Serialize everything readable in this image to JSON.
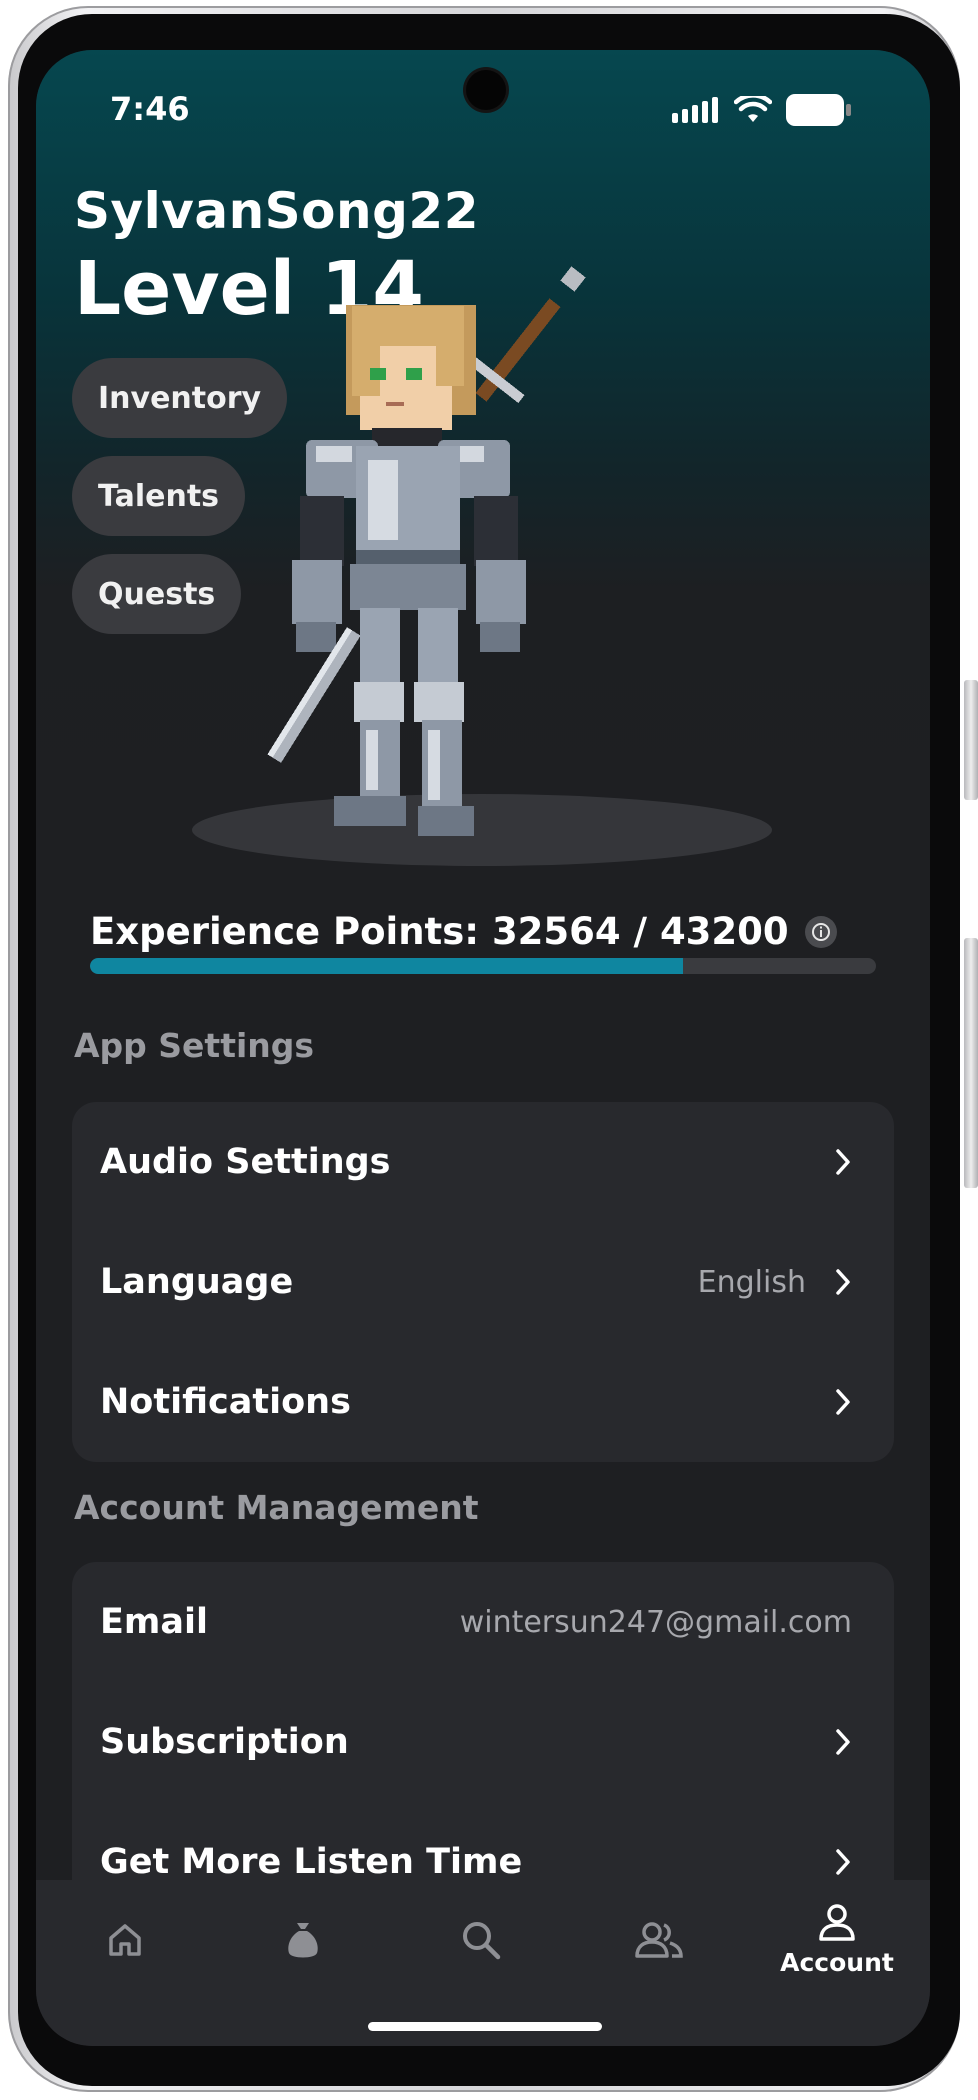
{
  "status_bar": {
    "time": "7:46"
  },
  "profile": {
    "username": "SylvanSong22",
    "level": "Level 14"
  },
  "menu_chips": [
    {
      "label": "Inventory"
    },
    {
      "label": "Talents"
    },
    {
      "label": "Quests"
    }
  ],
  "experience": {
    "label": "Experience Points: 32564 / 43200",
    "current": 32564,
    "max": 43200,
    "fraction": 0.754
  },
  "app_settings": {
    "title": "App Settings",
    "rows": [
      {
        "label": "Audio Settings",
        "value": ""
      },
      {
        "label": "Language",
        "value": "English"
      },
      {
        "label": "Notifications",
        "value": ""
      }
    ]
  },
  "account_management": {
    "title": "Account Management",
    "rows": [
      {
        "label": "Email",
        "value": "wintersun247@gmail.com"
      },
      {
        "label": "Subscription",
        "value": ""
      },
      {
        "label": "Get More Listen Time",
        "value": ""
      }
    ]
  },
  "bottom_nav": {
    "items": [
      {
        "icon": "home-icon",
        "label": ""
      },
      {
        "icon": "bag-icon",
        "label": ""
      },
      {
        "icon": "search-icon",
        "label": ""
      },
      {
        "icon": "people-icon",
        "label": ""
      },
      {
        "icon": "account-icon",
        "label": "Account"
      }
    ]
  },
  "colors": {
    "accent": "#0f86a0",
    "background": "#1e1f22",
    "card": "#28292d",
    "hero_top": "#06474f"
  }
}
